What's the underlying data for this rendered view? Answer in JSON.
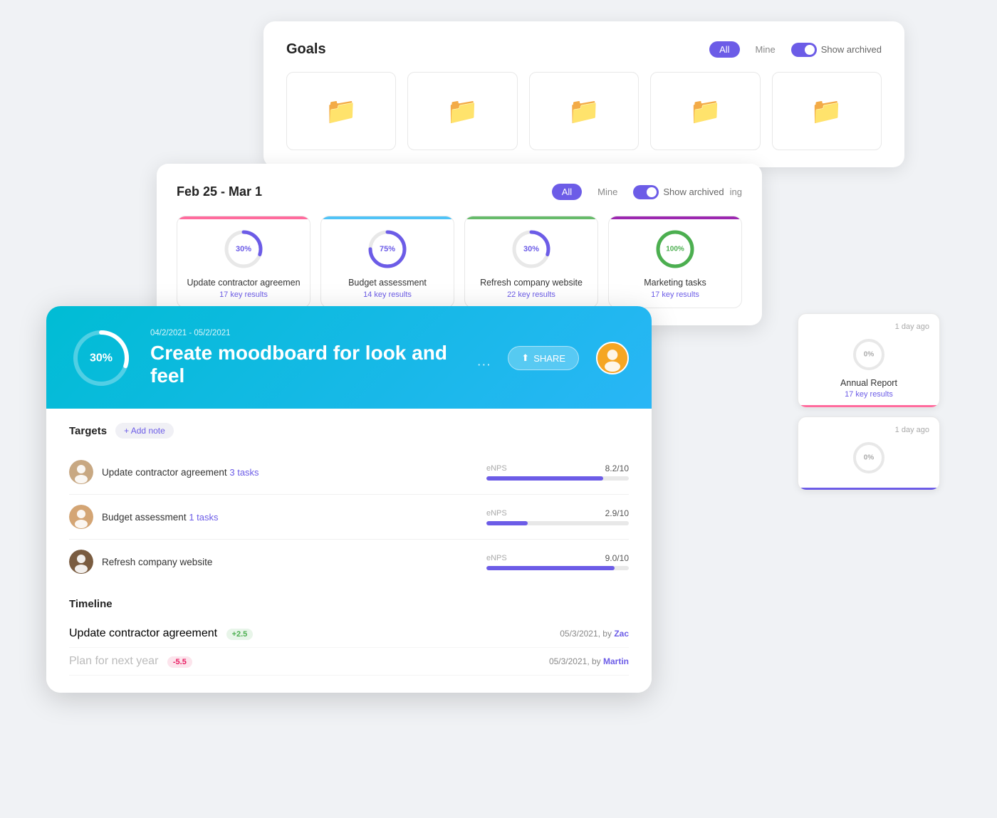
{
  "goals_panel": {
    "title": "Goals",
    "filter_all": "All",
    "filter_mine": "Mine",
    "toggle_label": "Show archived",
    "folders": [
      {
        "id": 1
      },
      {
        "id": 2
      },
      {
        "id": 3
      },
      {
        "id": 4
      },
      {
        "id": 5
      }
    ]
  },
  "weekly_panel": {
    "date_range": "Feb 25 - Mar 1",
    "filter_all": "All",
    "filter_mine": "Mine",
    "toggle_label": "Show archived",
    "partial_label": "ing",
    "goal_cards": [
      {
        "name": "Update contractor agreemen",
        "key_results": "17 key results",
        "percent": 30,
        "color": "pink",
        "stroke_color": "#6c5ce7",
        "text_color": "#6c5ce7"
      },
      {
        "name": "Budget assessment",
        "key_results": "14 key results",
        "percent": 75,
        "color": "blue",
        "stroke_color": "#6c5ce7",
        "text_color": "#6c5ce7"
      },
      {
        "name": "Refresh company website",
        "key_results": "22 key results",
        "percent": 30,
        "color": "green",
        "stroke_color": "#6c5ce7",
        "text_color": "#6c5ce7"
      },
      {
        "name": "Marketing tasks",
        "key_results": "17 key results",
        "percent": 100,
        "color": "purple",
        "stroke_color": "#4caf50",
        "text_color": "#4caf50"
      }
    ]
  },
  "right_cards": [
    {
      "timestamp": "1 day ago",
      "percent": 0,
      "name": "Annual Report",
      "key_results": "17 key results",
      "bottom_color": "pink-bottom"
    },
    {
      "timestamp": "1 day ago",
      "percent": 0,
      "name": "",
      "key_results": "",
      "bottom_color": "purple-bottom"
    }
  ],
  "main_panel": {
    "date_range": "04/2/2021 - 05/2/2021",
    "title": "Create moodboard for look and feel",
    "percent": 30,
    "share_label": "SHARE",
    "targets_label": "Targets",
    "add_note_label": "+ Add note",
    "targets": [
      {
        "name": "Update contractor agreement",
        "link_text": "3 tasks",
        "metric_label": "eNPS",
        "metric_value": "8.2/10",
        "progress": 82,
        "avatar_char": "👤"
      },
      {
        "name": "Budget assessment",
        "link_text": "1 tasks",
        "metric_label": "eNPS",
        "metric_value": "2.9/10",
        "progress": 29,
        "avatar_char": "👤"
      },
      {
        "name": "Refresh company website",
        "link_text": "",
        "metric_label": "eNPS",
        "metric_value": "9.0/10",
        "progress": 90,
        "avatar_char": "👤"
      }
    ],
    "timeline_label": "Timeline",
    "timeline_rows": [
      {
        "label": "Update contractor agreement",
        "badge": "+2.5",
        "badge_type": "green",
        "date": "05/3/2021, by",
        "author": "Zac",
        "dimmed": false
      },
      {
        "label": "Plan for next year",
        "badge": "-5.5",
        "badge_type": "red",
        "date": "05/3/2021, by",
        "author": "Martin",
        "dimmed": true
      }
    ]
  }
}
